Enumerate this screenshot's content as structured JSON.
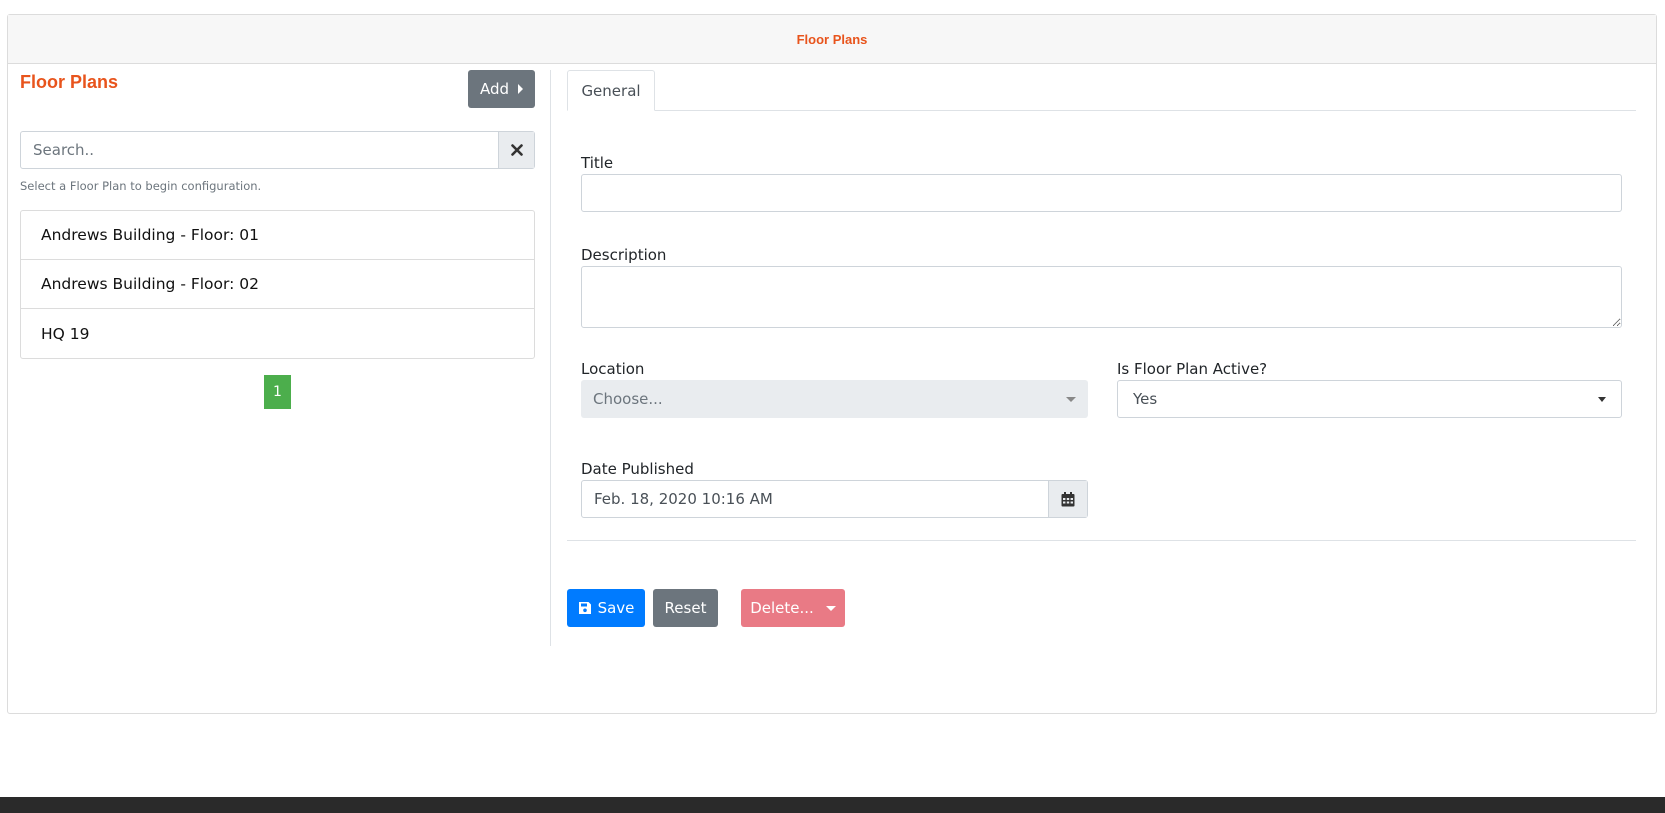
{
  "header": {
    "title": "Floor Plans"
  },
  "left_panel": {
    "title": "Floor Plans",
    "add_label": "Add",
    "search": {
      "placeholder": "Search..",
      "value": ""
    },
    "hint": "Select a Floor Plan to begin configuration.",
    "items": [
      {
        "label": "Andrews Building - Floor: 01"
      },
      {
        "label": "Andrews Building - Floor: 02"
      },
      {
        "label": "HQ 19"
      }
    ],
    "pagination": {
      "current_page": "1"
    }
  },
  "form": {
    "tabs": [
      {
        "label": "General"
      }
    ],
    "title_label": "Title",
    "title_value": "",
    "description_label": "Description",
    "description_value": "",
    "location_label": "Location",
    "location_placeholder": "Choose...",
    "active_label": "Is Floor Plan Active?",
    "active_value": "Yes",
    "date_label": "Date Published",
    "date_value": "Feb. 18, 2020 10:16 AM",
    "save_label": "Save",
    "reset_label": "Reset",
    "delete_label": "Delete..."
  },
  "colors": {
    "brand_orange": "#e8541c",
    "primary": "#007bff",
    "secondary": "#6c757d",
    "danger_light": "#e97a85",
    "success": "#4cae4c"
  }
}
